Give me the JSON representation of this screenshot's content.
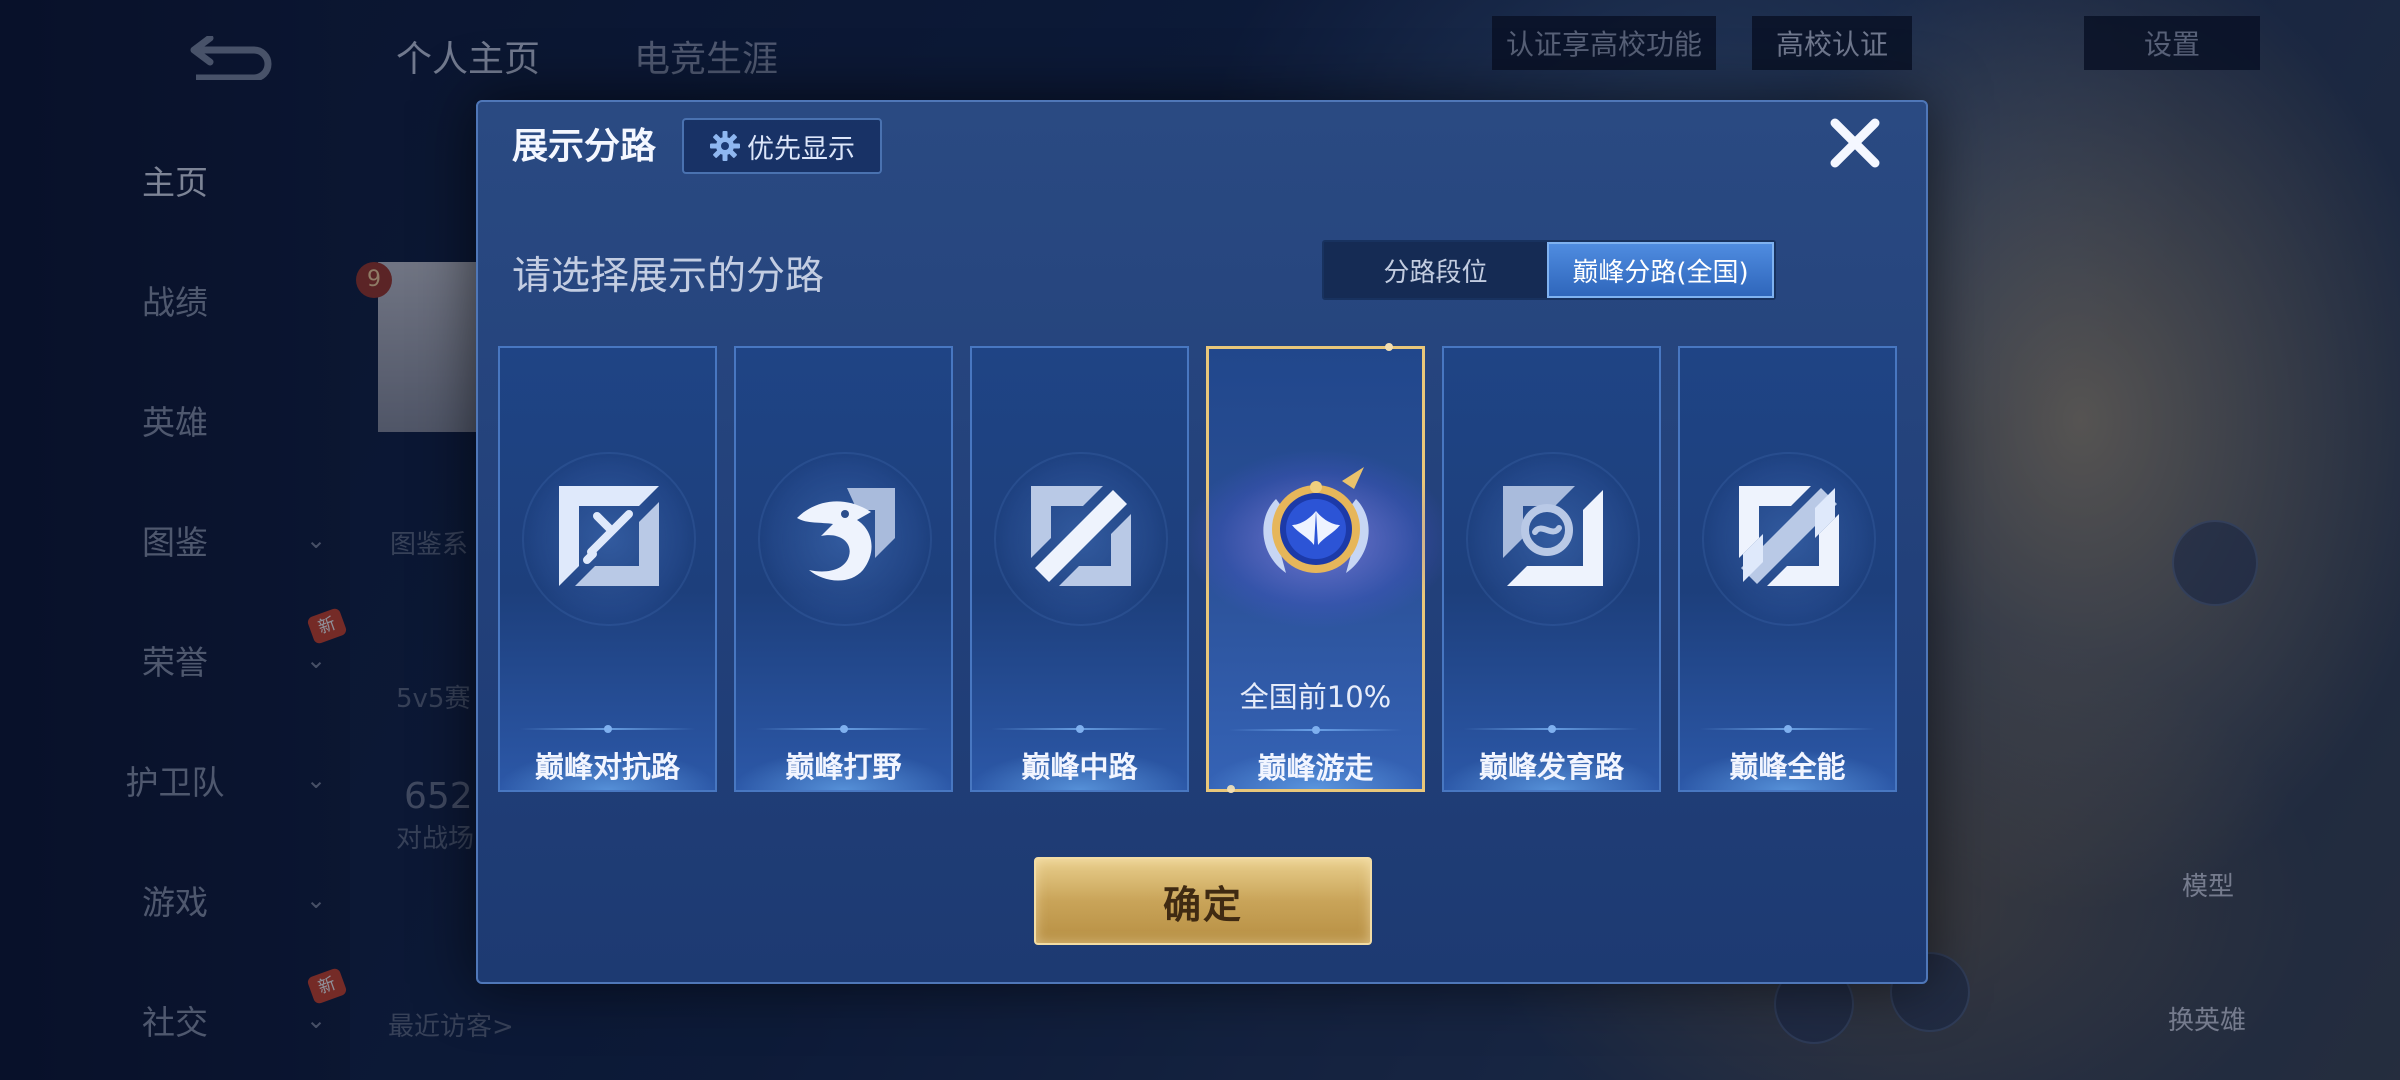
{
  "background": {
    "back_icon": "back-arrow-icon",
    "nav": [
      {
        "label": "主页",
        "active": true,
        "has_chevron": false,
        "new": false
      },
      {
        "label": "战绩",
        "active": false,
        "has_chevron": false,
        "new": false
      },
      {
        "label": "英雄",
        "active": false,
        "has_chevron": false,
        "new": false
      },
      {
        "label": "图鉴",
        "active": false,
        "has_chevron": true,
        "new": false
      },
      {
        "label": "荣誉",
        "active": false,
        "has_chevron": true,
        "new": true
      },
      {
        "label": "护卫队",
        "active": false,
        "has_chevron": true,
        "new": false
      },
      {
        "label": "游戏",
        "active": false,
        "has_chevron": true,
        "new": false
      },
      {
        "label": "社交",
        "active": false,
        "has_chevron": true,
        "new": true
      }
    ],
    "new_badge": "新",
    "top_tabs": [
      "个人主页",
      "电竞生涯"
    ],
    "top_right": {
      "verify": "认证享高校功能",
      "campus": "高校认证",
      "settings": "设置"
    },
    "profile": {
      "level": "9",
      "codex": "图鉴系",
      "mode": "5v5赛",
      "number": "652",
      "battle": "对战场",
      "visitors": "最近访客>"
    },
    "right_panel": {
      "model": "模型",
      "swap_hero": "换英雄"
    }
  },
  "dialog": {
    "title": "展示分路",
    "priority_button": "优先显示",
    "subtitle": "请选择展示的分路",
    "toggle": {
      "options": [
        "分路段位",
        "巅峰分路(全国)"
      ],
      "selected": "巅峰分路(全国)"
    },
    "lanes": [
      {
        "label": "巅峰对抗路",
        "icon": "clash-lane-icon",
        "selected": false
      },
      {
        "label": "巅峰打野",
        "icon": "jungle-dragon-icon",
        "selected": false
      },
      {
        "label": "巅峰中路",
        "icon": "mid-lane-icon",
        "selected": false
      },
      {
        "label": "巅峰游走",
        "icon": "roam-winged-badge-icon",
        "selected": true,
        "rank_text": "全国前10%"
      },
      {
        "label": "巅峰发育路",
        "icon": "farm-lane-icon",
        "selected": false
      },
      {
        "label": "巅峰全能",
        "icon": "all-round-icon",
        "selected": false
      }
    ],
    "confirm": "确定"
  }
}
